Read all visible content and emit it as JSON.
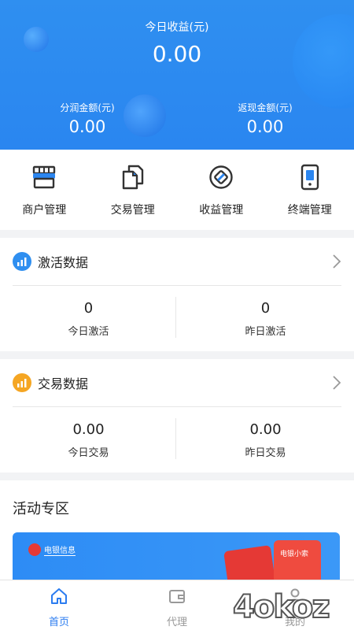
{
  "header": {
    "today_income_label": "今日收益(元)",
    "today_income_value": "0.00",
    "split_label": "分润金额(元)",
    "split_value": "0.00",
    "cashback_label": "返现金额(元)",
    "cashback_value": "0.00"
  },
  "menu": {
    "items": [
      {
        "label": "商户管理",
        "icon": "store-icon"
      },
      {
        "label": "交易管理",
        "icon": "document-icon"
      },
      {
        "label": "收益管理",
        "icon": "diamond-icon"
      },
      {
        "label": "终端管理",
        "icon": "terminal-icon"
      }
    ]
  },
  "activation": {
    "title": "激活数据",
    "today_value": "0",
    "today_label": "今日激活",
    "yesterday_value": "0",
    "yesterday_label": "昨日激活"
  },
  "transaction": {
    "title": "交易数据",
    "today_value": "0.00",
    "today_label": "今日交易",
    "yesterday_value": "0.00",
    "yesterday_label": "昨日交易"
  },
  "activity": {
    "title": "活动专区",
    "banner_logo_text": "电银信息",
    "banner_device_text": "电银小索"
  },
  "tabbar": {
    "items": [
      {
        "label": "首页",
        "icon": "home-icon",
        "active": true
      },
      {
        "label": "代理",
        "icon": "wallet-icon",
        "active": false
      },
      {
        "label": "我的",
        "icon": "user-icon",
        "active": false
      }
    ]
  },
  "watermark": "4okoz",
  "colors": {
    "primary": "#2b86f0",
    "tab_active": "#2b7cf0",
    "activation_badge": "#2f8ff0",
    "transaction_badge": "#f5a623"
  }
}
